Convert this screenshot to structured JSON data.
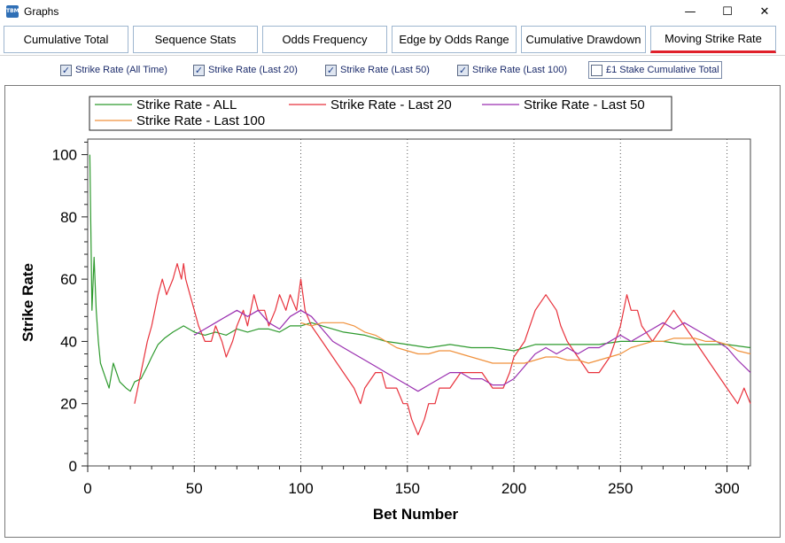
{
  "window": {
    "title": "Graphs",
    "app_icon_text": "TBM",
    "minimize": "—",
    "maximize": "☐",
    "close": "✕"
  },
  "tabs": [
    {
      "label": "Cumulative Total",
      "active": false
    },
    {
      "label": "Sequence Stats",
      "active": false
    },
    {
      "label": "Odds Frequency",
      "active": false
    },
    {
      "label": "Edge by Odds Range",
      "active": false
    },
    {
      "label": "Cumulative Drawdown",
      "active": false
    },
    {
      "label": "Moving Strike Rate",
      "active": true
    }
  ],
  "checkboxes": [
    {
      "label": "Strike Rate (All Time)",
      "checked": true
    },
    {
      "label": "Strike Rate (Last 20)",
      "checked": true
    },
    {
      "label": "Strike Rate (Last 50)",
      "checked": true
    },
    {
      "label": "Strike Rate (Last 100)",
      "checked": true
    },
    {
      "label": "£1 Stake Cumulative Total",
      "checked": false
    }
  ],
  "colors": {
    "all": "#2e9a2e",
    "last20": "#e8323c",
    "last50": "#9a2fb0",
    "last100": "#f0913c",
    "accent": "#e0202a"
  },
  "chart_data": {
    "type": "line",
    "xlabel": "Bet Number",
    "ylabel": "Strike Rate",
    "xlim": [
      0,
      311
    ],
    "ylim": [
      0,
      105
    ],
    "xticks": [
      0,
      50,
      100,
      150,
      200,
      250,
      300
    ],
    "yticks": [
      0,
      20,
      40,
      60,
      80,
      100
    ],
    "grid": "vertical dotted",
    "legend_position": "top",
    "series": [
      {
        "name": "Strike Rate - ALL",
        "color": "#2e9a2e",
        "x": [
          1,
          2,
          3,
          4,
          5,
          6,
          8,
          10,
          12,
          15,
          18,
          20,
          22,
          25,
          28,
          30,
          33,
          36,
          40,
          45,
          50,
          55,
          60,
          65,
          70,
          75,
          80,
          85,
          90,
          95,
          100,
          105,
          110,
          115,
          120,
          130,
          140,
          150,
          160,
          170,
          180,
          190,
          200,
          210,
          220,
          230,
          240,
          250,
          260,
          270,
          280,
          290,
          300,
          311
        ],
        "values": [
          100,
          50,
          67,
          50,
          40,
          33,
          29,
          25,
          33,
          27,
          25,
          24,
          27,
          28,
          32,
          35,
          39,
          41,
          43,
          45,
          43,
          42,
          43,
          42,
          44,
          43,
          44,
          44,
          43,
          45,
          45,
          46,
          45,
          44,
          43,
          42,
          40,
          39,
          38,
          39,
          38,
          38,
          37,
          39,
          39,
          39,
          39,
          40,
          40,
          40,
          39,
          39,
          39,
          38
        ]
      },
      {
        "name": "Strike Rate - Last 20",
        "color": "#e8323c",
        "x": [
          22,
          25,
          28,
          30,
          33,
          35,
          37,
          40,
          42,
          44,
          45,
          46,
          48,
          50,
          52,
          55,
          58,
          60,
          63,
          65,
          68,
          70,
          73,
          75,
          78,
          80,
          83,
          85,
          88,
          90,
          93,
          95,
          98,
          100,
          102,
          105,
          110,
          115,
          120,
          125,
          128,
          130,
          135,
          138,
          140,
          145,
          148,
          150,
          152,
          155,
          158,
          160,
          163,
          165,
          170,
          175,
          180,
          185,
          190,
          195,
          198,
          200,
          205,
          210,
          215,
          220,
          222,
          225,
          230,
          235,
          240,
          245,
          250,
          253,
          255,
          258,
          260,
          265,
          270,
          275,
          280,
          285,
          290,
          295,
          300,
          305,
          308,
          311
        ],
        "values": [
          20,
          30,
          40,
          45,
          55,
          60,
          55,
          60,
          65,
          60,
          65,
          60,
          55,
          50,
          45,
          40,
          40,
          45,
          40,
          35,
          40,
          45,
          50,
          45,
          55,
          50,
          50,
          45,
          50,
          55,
          50,
          55,
          50,
          60,
          50,
          45,
          40,
          35,
          30,
          25,
          20,
          25,
          30,
          30,
          25,
          25,
          20,
          20,
          15,
          10,
          15,
          20,
          20,
          25,
          25,
          30,
          30,
          30,
          25,
          25,
          30,
          35,
          40,
          50,
          55,
          50,
          45,
          40,
          35,
          30,
          30,
          35,
          45,
          55,
          50,
          50,
          45,
          40,
          45,
          50,
          45,
          40,
          35,
          30,
          25,
          20,
          25,
          20
        ]
      },
      {
        "name": "Strike Rate - Last 50",
        "color": "#9a2fb0",
        "x": [
          50,
          55,
          60,
          65,
          70,
          75,
          80,
          85,
          90,
          95,
          100,
          105,
          110,
          115,
          120,
          125,
          130,
          135,
          140,
          145,
          150,
          155,
          160,
          165,
          170,
          175,
          180,
          185,
          190,
          195,
          200,
          205,
          210,
          215,
          220,
          225,
          230,
          235,
          240,
          245,
          250,
          255,
          260,
          265,
          270,
          275,
          280,
          285,
          290,
          295,
          300,
          305,
          311
        ],
        "values": [
          42,
          44,
          46,
          48,
          50,
          48,
          50,
          46,
          44,
          48,
          50,
          48,
          44,
          40,
          38,
          36,
          34,
          32,
          30,
          28,
          26,
          24,
          26,
          28,
          30,
          30,
          28,
          28,
          26,
          26,
          28,
          32,
          36,
          38,
          36,
          38,
          36,
          38,
          38,
          40,
          42,
          40,
          42,
          44,
          46,
          44,
          46,
          44,
          42,
          40,
          38,
          34,
          30
        ]
      },
      {
        "name": "Strike Rate - Last 100",
        "color": "#f0913c",
        "x": [
          100,
          105,
          110,
          115,
          120,
          125,
          130,
          135,
          140,
          145,
          150,
          155,
          160,
          165,
          170,
          175,
          180,
          185,
          190,
          195,
          200,
          205,
          210,
          215,
          220,
          225,
          230,
          235,
          240,
          245,
          250,
          255,
          260,
          265,
          270,
          275,
          280,
          285,
          290,
          295,
          300,
          305,
          311
        ],
        "values": [
          46,
          45,
          46,
          46,
          46,
          45,
          43,
          42,
          40,
          38,
          37,
          36,
          36,
          37,
          37,
          36,
          35,
          34,
          33,
          33,
          33,
          33,
          34,
          35,
          35,
          34,
          34,
          33,
          34,
          35,
          36,
          38,
          39,
          40,
          40,
          41,
          41,
          41,
          40,
          40,
          39,
          37,
          36
        ]
      }
    ]
  }
}
